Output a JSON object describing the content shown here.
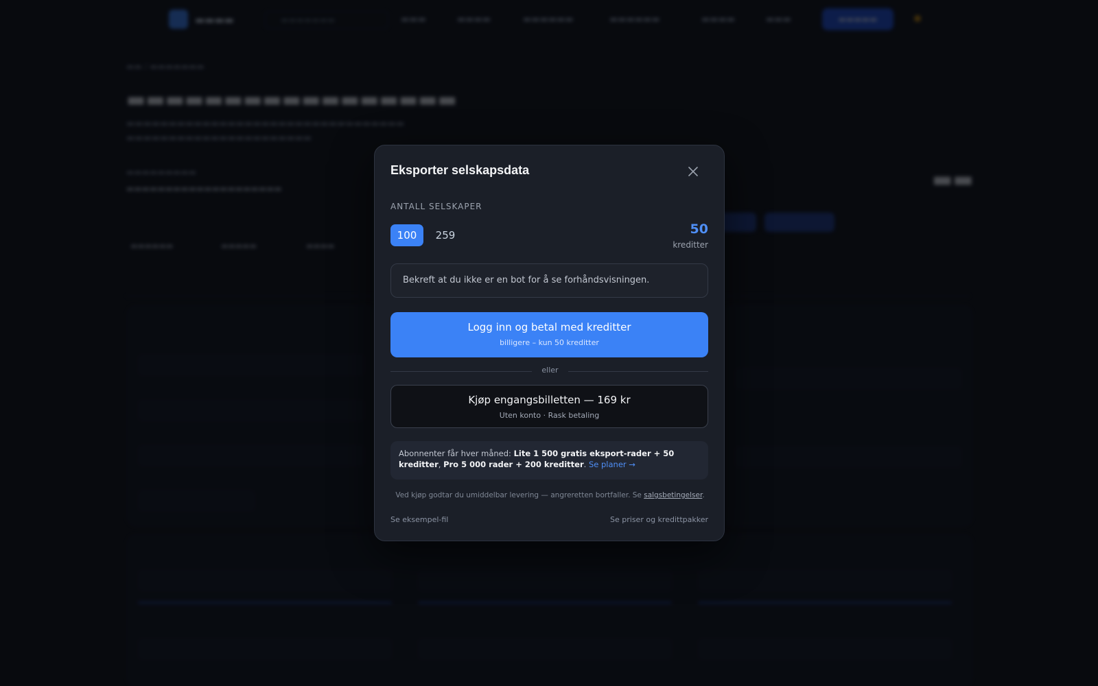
{
  "modal": {
    "title": "Eksporter selskapsdata",
    "section_label": "ANTALL SELSKAPER",
    "options": [
      "100",
      "259"
    ],
    "selected_option": "100",
    "credits_value": "50",
    "credits_label": "kreditter",
    "captcha_text": "Bekreft at du ikke er en bot for å se forhåndsvisningen.",
    "primary_button": {
      "label": "Logg inn og betal med kreditter",
      "sublabel": "billigere – kun 50 kreditter"
    },
    "divider_text": "eller",
    "secondary_button": {
      "label": "Kjøp engangsbilletten — 169 kr",
      "sublabel": "Uten konto · Rask betaling"
    },
    "promo": {
      "prefix": "Abonnenter får hver måned: ",
      "lite": "Lite 1 500 gratis eksport-rader + 50 kreditter",
      "sep": ", ",
      "pro": "Pro 5 000 rader + 200 kreditter",
      "end": ". ",
      "link": "Se planer →"
    },
    "legal": {
      "text": "Ved kjøp godtar du umiddelbar levering — angreretten bortfaller. Se ",
      "link": "salgsbetingelser",
      "end": "."
    },
    "footer_left": "Se eksempel-fil",
    "footer_right": "Se priser og kredittpakker"
  },
  "colors": {
    "accent": "#3b82f6",
    "modal_bg": "#1b1f28",
    "page_bg": "#0b0d12"
  },
  "icons": {
    "close": "close-icon"
  }
}
